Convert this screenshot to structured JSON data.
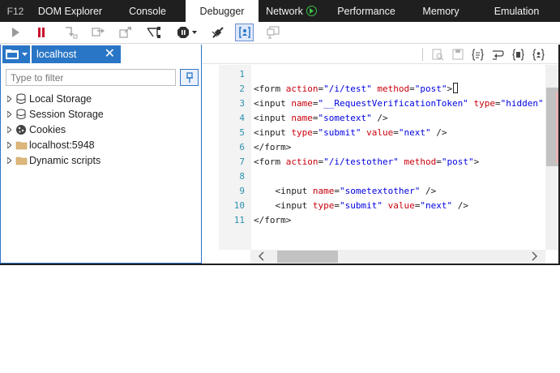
{
  "tabs": {
    "f12": "F12",
    "dom_explorer": "DOM Explorer",
    "console": "Console",
    "debugger": "Debugger",
    "network": "Network",
    "performance": "Performance",
    "memory": "Memory",
    "emulation": "Emulation",
    "active": "Debugger"
  },
  "toolbar": {
    "icons": [
      "play-icon",
      "break-all-icon",
      "step-into-icon",
      "step-over-icon",
      "step-out-icon",
      "break-on-new-worker-icon",
      "exception-behavior-icon",
      "disconnect-icon",
      "just-my-code-icon",
      "deprioritize-icon"
    ],
    "active_icon": "just-my-code-icon"
  },
  "source_tab": {
    "label": "localhost",
    "close": "✕"
  },
  "filter": {
    "placeholder": "Type to filter"
  },
  "tree": [
    {
      "label": "Local Storage",
      "icon": "storage-icon"
    },
    {
      "label": "Session Storage",
      "icon": "storage-icon"
    },
    {
      "label": "Cookies",
      "icon": "cookie-icon"
    },
    {
      "label": "localhost:5948",
      "icon": "folder-icon"
    },
    {
      "label": "Dynamic scripts",
      "icon": "folder-icon"
    }
  ],
  "editor": {
    "lines": [
      {
        "n": "1",
        "parts": []
      },
      {
        "n": "2",
        "parts": [
          [
            "t",
            "<form "
          ],
          [
            "a",
            "action"
          ],
          [
            "t",
            "="
          ],
          [
            "v",
            "\"/i/test\""
          ],
          [
            "t",
            " "
          ],
          [
            "a",
            "method"
          ],
          [
            "t",
            "="
          ],
          [
            "v",
            "\"post\""
          ],
          [
            "t",
            ">"
          ]
        ],
        "caret": true
      },
      {
        "n": "3",
        "parts": [
          [
            "t",
            "<input "
          ],
          [
            "a",
            "name"
          ],
          [
            "t",
            "="
          ],
          [
            "v",
            "\"__RequestVerificationToken\""
          ],
          [
            "t",
            " "
          ],
          [
            "a",
            "type"
          ],
          [
            "t",
            "="
          ],
          [
            "v",
            "\"hidden\""
          ],
          [
            "t",
            " "
          ],
          [
            "a",
            "va"
          ]
        ]
      },
      {
        "n": "4",
        "parts": [
          [
            "t",
            "<input "
          ],
          [
            "a",
            "name"
          ],
          [
            "t",
            "="
          ],
          [
            "v",
            "\"sometext\""
          ],
          [
            "t",
            " />"
          ]
        ]
      },
      {
        "n": "5",
        "parts": [
          [
            "t",
            "<input "
          ],
          [
            "a",
            "type"
          ],
          [
            "t",
            "="
          ],
          [
            "v",
            "\"submit\""
          ],
          [
            "t",
            " "
          ],
          [
            "a",
            "value"
          ],
          [
            "t",
            "="
          ],
          [
            "v",
            "\"next\""
          ],
          [
            "t",
            " />"
          ]
        ]
      },
      {
        "n": "6",
        "parts": [
          [
            "t",
            "</form>"
          ]
        ]
      },
      {
        "n": "7",
        "parts": [
          [
            "t",
            "<form "
          ],
          [
            "a",
            "action"
          ],
          [
            "t",
            "="
          ],
          [
            "v",
            "\"/i/testother\""
          ],
          [
            "t",
            " "
          ],
          [
            "a",
            "method"
          ],
          [
            "t",
            "="
          ],
          [
            "v",
            "\"post\""
          ],
          [
            "t",
            ">"
          ]
        ]
      },
      {
        "n": "8",
        "parts": []
      },
      {
        "n": "9",
        "parts": [
          [
            "t",
            "    <input "
          ],
          [
            "a",
            "name"
          ],
          [
            "t",
            "="
          ],
          [
            "v",
            "\"sometextother\""
          ],
          [
            "t",
            " />"
          ]
        ]
      },
      {
        "n": "10",
        "parts": [
          [
            "t",
            "    <input "
          ],
          [
            "a",
            "type"
          ],
          [
            "t",
            "="
          ],
          [
            "v",
            "\"submit\""
          ],
          [
            "t",
            " "
          ],
          [
            "a",
            "value"
          ],
          [
            "t",
            "="
          ],
          [
            "v",
            "\"next\""
          ],
          [
            "t",
            " />"
          ]
        ]
      },
      {
        "n": "11",
        "parts": [
          [
            "t",
            "</form>"
          ]
        ]
      }
    ]
  },
  "colors": {
    "tabbar_bg": "#1f1f1f",
    "accent": "#2a76c6",
    "line_number": "#2b91af",
    "attr": "#c8000c",
    "value": "#0000e0"
  }
}
